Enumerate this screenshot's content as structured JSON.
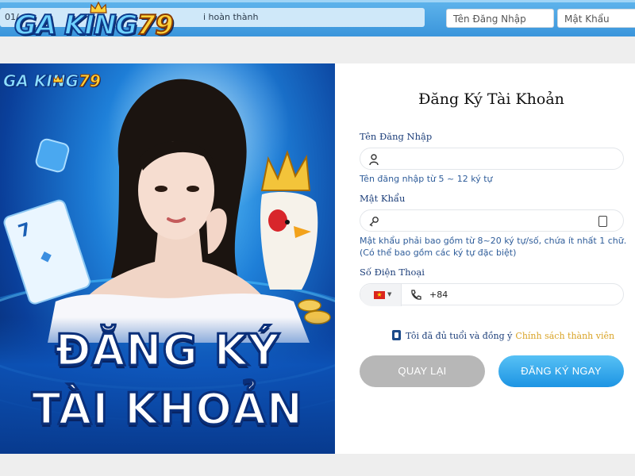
{
  "topbar": {
    "marquee_lead": "01/",
    "marquee_text": "i hoàn thành",
    "logo_main": "GA KING",
    "logo_number": "79",
    "username_placeholder": "Tên Đăng Nhập",
    "password_placeholder": "Mật Khẩu"
  },
  "banner": {
    "logo_main": "GA KING",
    "logo_number": "79",
    "title_line1": "ĐĂNG KÝ",
    "title_line2": "TÀI KHOẢN"
  },
  "form": {
    "title": "Đăng Ký Tài Khoản",
    "username": {
      "label": "Tên Đăng Nhập",
      "value": "",
      "hint": "Tên đăng nhập từ 5 ~ 12 ký tự"
    },
    "password": {
      "label": "Mật Khẩu",
      "value": "",
      "hint": "Mật khẩu phải bao gồm từ 8~20 ký tự/số, chứa ít nhất 1 chữ. (Có thể bao gồm các ký tự đặc biệt)"
    },
    "phone": {
      "label": "Số Điện Thoại",
      "country_code": "+84",
      "value": ""
    },
    "agree_text": "Tôi đã đủ tuổi và đồng ý",
    "agree_link": "Chính sách thành viên",
    "back_button": "QUAY LẠI",
    "submit_button": "ĐĂNG KÝ NGAY"
  },
  "colors": {
    "topbar": "#3a95db",
    "submit": "#1d94e3",
    "back": "#b7b7b7",
    "policy_link": "#d9a326",
    "label": "#1d3f7a"
  },
  "icons": [
    "user-icon",
    "key-icon",
    "phone-icon",
    "vietnam-flag-icon",
    "crown-icon"
  ]
}
